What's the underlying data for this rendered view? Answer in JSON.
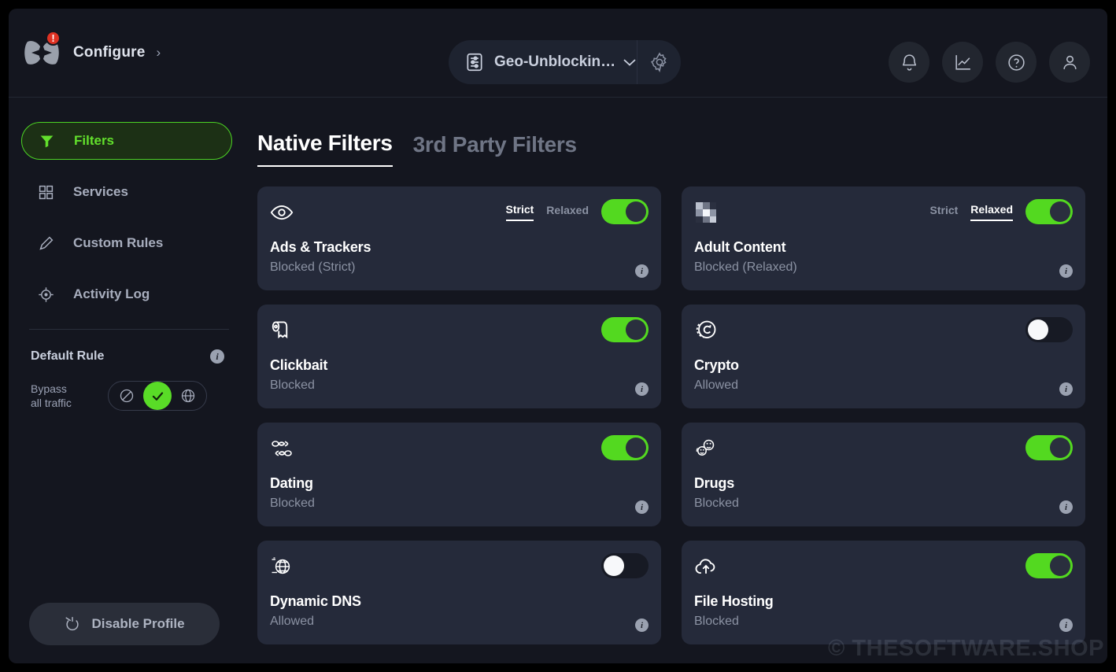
{
  "header": {
    "logo_badge": "!",
    "breadcrumb": "Configure",
    "breadcrumb_chevron": "›",
    "profile_name": "Geo-Unblockin…",
    "profile_chevron": "⌄",
    "icons": {
      "profile_list": "sliders-icon",
      "gear": "gear-icon",
      "bell": "bell-icon",
      "analytics": "chart-line-icon",
      "help": "question-circle-icon",
      "account": "user-icon"
    }
  },
  "sidebar": {
    "items": [
      {
        "label": "Filters",
        "icon": "funnel-icon",
        "active": true
      },
      {
        "label": "Services",
        "icon": "grid-icon",
        "active": false
      },
      {
        "label": "Custom Rules",
        "icon": "pencil-icon",
        "active": false
      },
      {
        "label": "Activity Log",
        "icon": "target-icon",
        "active": false
      }
    ],
    "default_rule": {
      "title": "Default Rule",
      "info": "i",
      "bypass_label_line1": "Bypass",
      "bypass_label_line2": "all traffic",
      "options": [
        {
          "name": "block",
          "icon": "no-entry-icon",
          "selected": false
        },
        {
          "name": "allow",
          "icon": "check-icon",
          "selected": true
        },
        {
          "name": "redirect",
          "icon": "globe-icon",
          "selected": false
        }
      ]
    },
    "disable_profile": {
      "label": "Disable Profile",
      "icon": "power-off-slash-icon"
    }
  },
  "main": {
    "tabs": [
      {
        "label": "Native Filters",
        "active": true
      },
      {
        "label": "3rd Party Filters",
        "active": false
      }
    ],
    "info_button": "i",
    "mode_strict": "Strict",
    "mode_relaxed": "Relaxed",
    "info_glyph": "i",
    "filters": [
      {
        "name": "Ads & Trackers",
        "status": "Blocked (Strict)",
        "icon": "eye-icon",
        "enabled": true,
        "has_modes": true,
        "mode_selected": "Strict"
      },
      {
        "name": "Adult Content",
        "status": "Blocked (Relaxed)",
        "icon": "pixelated-censor-icon",
        "enabled": true,
        "has_modes": true,
        "mode_selected": "Relaxed"
      },
      {
        "name": "Clickbait",
        "status": "Blocked",
        "icon": "toilet-paper-icon",
        "enabled": true,
        "has_modes": false,
        "mode_selected": ""
      },
      {
        "name": "Crypto",
        "status": "Allowed",
        "icon": "coin-icon",
        "enabled": false,
        "has_modes": false,
        "mode_selected": ""
      },
      {
        "name": "Dating",
        "status": "Blocked",
        "icon": "two-fish-icon",
        "enabled": true,
        "has_modes": false,
        "mode_selected": ""
      },
      {
        "name": "Drugs",
        "status": "Blocked",
        "icon": "smiley-pills-icon",
        "enabled": true,
        "has_modes": false,
        "mode_selected": ""
      },
      {
        "name": "Dynamic DNS",
        "status": "Allowed",
        "icon": "globe-motion-icon",
        "enabled": false,
        "has_modes": false,
        "mode_selected": ""
      },
      {
        "name": "File Hosting",
        "status": "Blocked",
        "icon": "cloud-upload-icon",
        "enabled": true,
        "has_modes": false,
        "mode_selected": ""
      }
    ]
  },
  "watermark": "© THESOFTWARE.SHOP",
  "colors": {
    "accent_green": "#53d920",
    "active_nav_bg": "#1c3015",
    "card_bg": "#252a3a",
    "app_bg": "#14161f",
    "alert_red": "#e03223"
  }
}
